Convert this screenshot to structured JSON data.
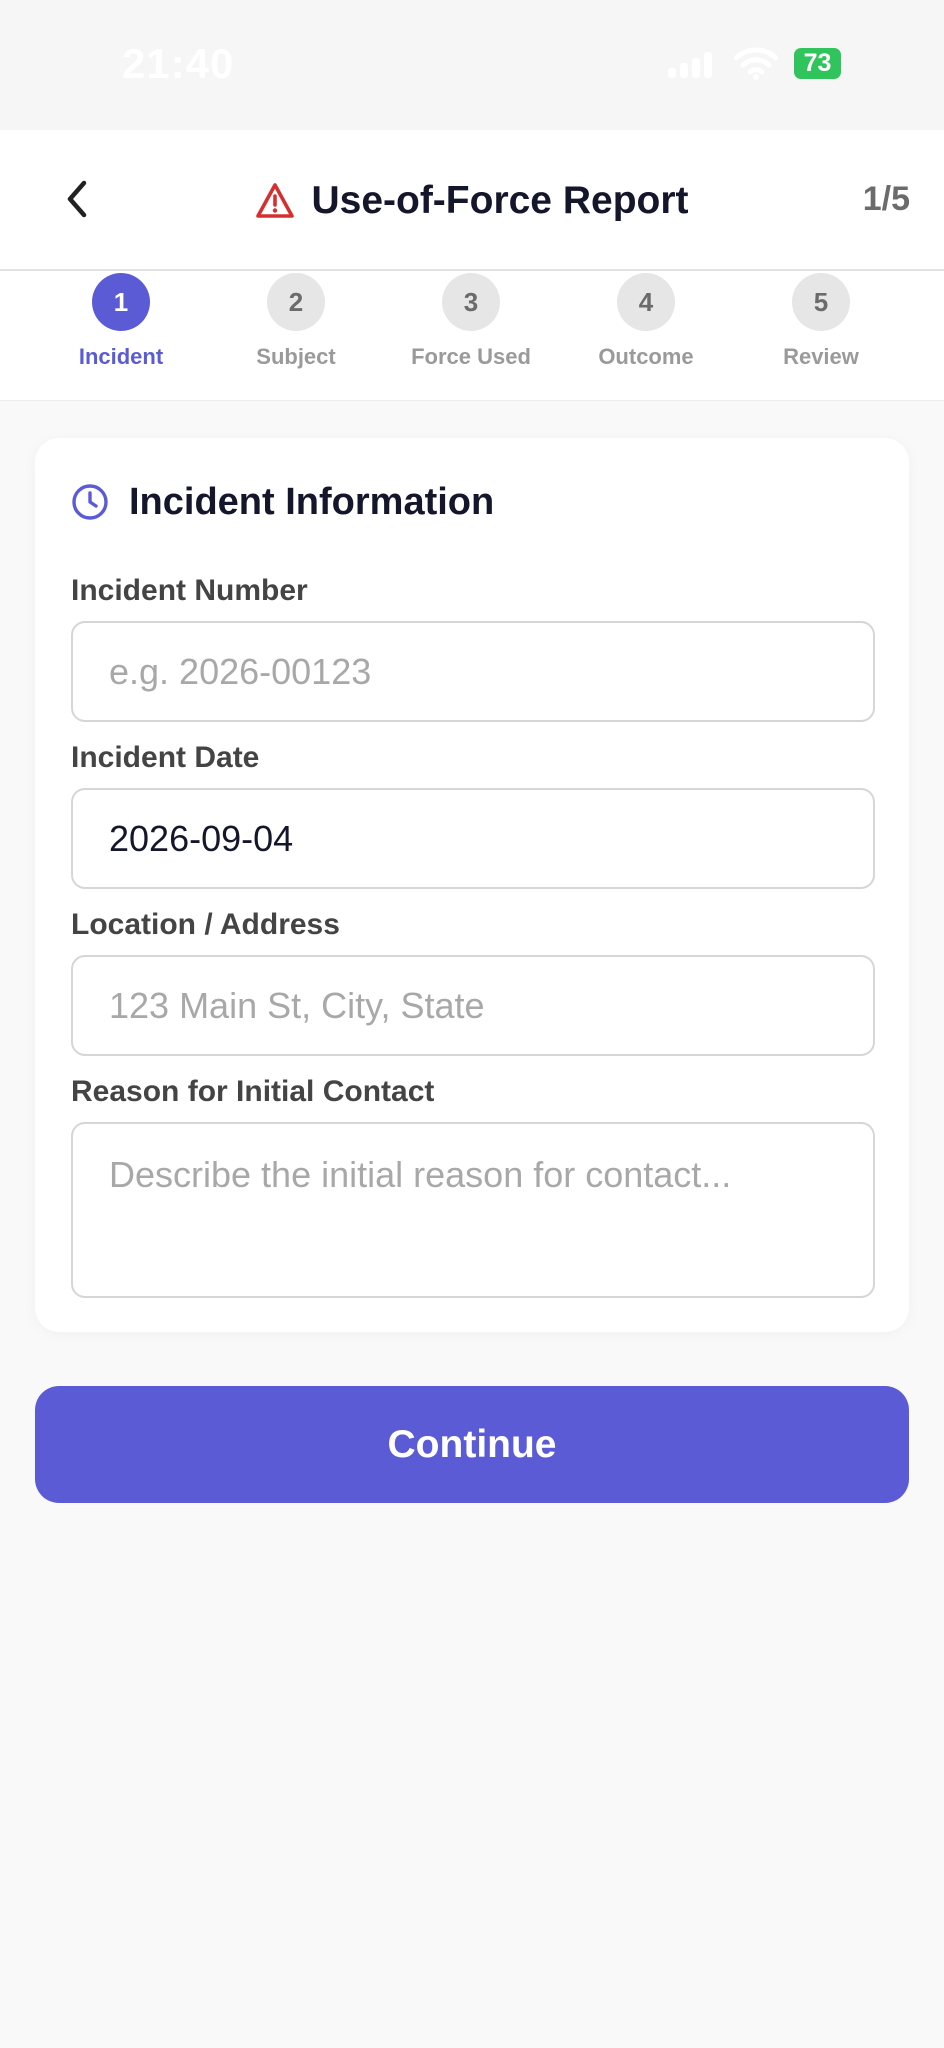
{
  "status_bar": {
    "time": "21:40",
    "battery_level": "73",
    "battery_color": "#30c45c"
  },
  "header": {
    "title": "Use-of-Force Report",
    "title_icon": "warning-triangle-icon",
    "back_icon": "chevron-left-icon",
    "step_counter": "1/5"
  },
  "stepper": {
    "active_index": 0,
    "steps": [
      {
        "number": "1",
        "label": "Incident"
      },
      {
        "number": "2",
        "label": "Subject"
      },
      {
        "number": "3",
        "label": "Force Used"
      },
      {
        "number": "4",
        "label": "Outcome"
      },
      {
        "number": "5",
        "label": "Review"
      }
    ]
  },
  "card": {
    "icon": "clock-icon",
    "title": "Incident Information",
    "fields": {
      "incident_number": {
        "label": "Incident Number",
        "value": "",
        "placeholder": "e.g. 2026-00123"
      },
      "incident_date": {
        "label": "Incident Date",
        "value": "2026-09-04",
        "placeholder": ""
      },
      "location": {
        "label": "Location / Address",
        "value": "",
        "placeholder": "123 Main St, City, State"
      },
      "reason": {
        "label": "Reason for Initial Contact",
        "value": "",
        "placeholder": "Describe the initial reason for contact..."
      }
    }
  },
  "actions": {
    "continue_label": "Continue"
  },
  "colors": {
    "accent": "#5b5bd6",
    "warning": "#d62f2f",
    "background": "#f9f9f9"
  }
}
